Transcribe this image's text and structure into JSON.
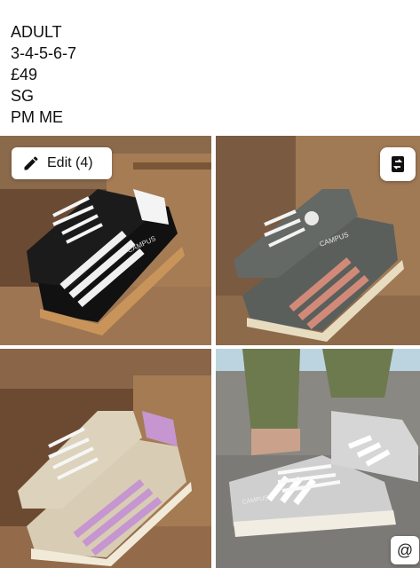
{
  "caption": {
    "lines": [
      "ADULT",
      "3-4-5-6-7",
      "£49",
      "SG",
      "PM ME"
    ]
  },
  "toolbar": {
    "edit_label": "Edit (4)",
    "edit_icon": "pencil-icon",
    "swap_icon": "swap-photo-icon",
    "at_label": "@"
  },
  "photos": [
    {
      "shoe_color": "#121212",
      "stripe_color": "#f2f2f2",
      "brand_text": "CAMPUS"
    },
    {
      "shoe_color": "#5b5f5c",
      "stripe_color": "#d28a78",
      "brand_text": "CAMPUS"
    },
    {
      "shoe_color": "#d8cdb4",
      "stripe_color": "#c596cf",
      "brand_text": ""
    },
    {
      "shoe_color": "#cfcfcf",
      "stripe_color": "#ffffff",
      "brand_text": "CAMPUS"
    }
  ]
}
